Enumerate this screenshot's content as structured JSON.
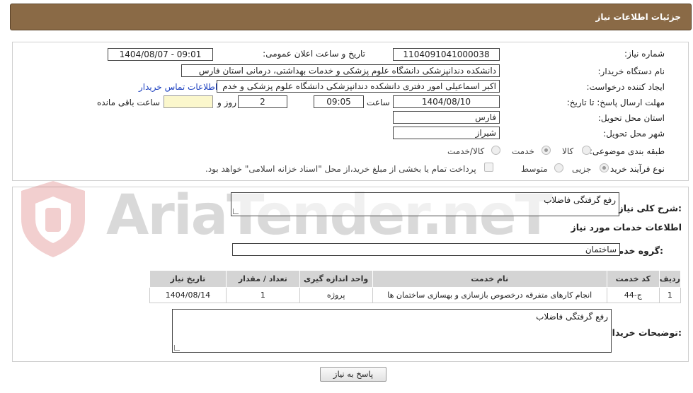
{
  "header": {
    "title": "جزئیات اطلاعات نیاز"
  },
  "form": {
    "need_number_label": "شماره نیاز:",
    "need_number": "1104091041000038",
    "announce_label": "تاریخ و ساعت اعلان عمومی:",
    "announce_value": "1404/08/07 - 09:01",
    "buyer_label": "نام دستگاه خریدار:",
    "buyer_value": "دانشکده دندانپزشکی دانشگاه علوم پزشکی و خدمات بهداشتی، درمانی استان فارس",
    "creator_label": "ایجاد کننده درخواست:",
    "creator_value": "اکبر  اسماعیلی امور دفتری دانشکده دندانپزشکی دانشگاه علوم پزشکی و خدم",
    "contact_link": "اطلاعات تماس خریدار",
    "deadline_label": "مهلت ارسال پاسخ: تا تاریخ:",
    "deadline_date": "1404/08/10",
    "time_label": "ساعت",
    "deadline_time": "09:05",
    "days_value": "2",
    "days_label": "روز و",
    "remaining_value": "",
    "remaining_label": "ساعت باقی مانده",
    "province_label": "استان محل تحویل:",
    "province_value": "فارس",
    "city_label": "شهر محل تحویل:",
    "city_value": "شیراز",
    "category_label": "طبقه بندی موضوعی:",
    "category_options": [
      "کالا",
      "خدمت",
      "کالا/خدمت"
    ],
    "category_selected": "خدمت",
    "process_label": "نوع فرآیند خرید :",
    "process_options": [
      "جزیی",
      "متوسط"
    ],
    "payment_note": "پرداخت تمام یا بخشی از مبلغ خرید،از محل \"اسناد خزانه اسلامی\" خواهد بود."
  },
  "details": {
    "summary_label": "شرح کلی نیاز:",
    "summary_value": "رفع گرفتگی فاضلاب",
    "services_title": "اطلاعات خدمات مورد نیاز",
    "group_label": "گروه خدمت:",
    "group_value": "ساختمان",
    "table": {
      "headers": [
        "ردیف",
        "کد خدمت",
        "نام خدمت",
        "واحد اندازه گیری",
        "تعداد / مقدار",
        "تاریخ نیاز"
      ],
      "rows": [
        [
          "1",
          "ج-44",
          "انجام کارهای متفرقه درخصوص بازسازی و بهسازی ساختمان ها",
          "پروژه",
          "1",
          "1404/08/14"
        ]
      ]
    },
    "buyer_notes_label": "توضیحات خریدار:",
    "buyer_notes_value": "رفع گرفتگی فاضلاب",
    "reply_button": "پاسخ به نیاز"
  },
  "watermark": {
    "text": "AriaTender.neT"
  }
}
